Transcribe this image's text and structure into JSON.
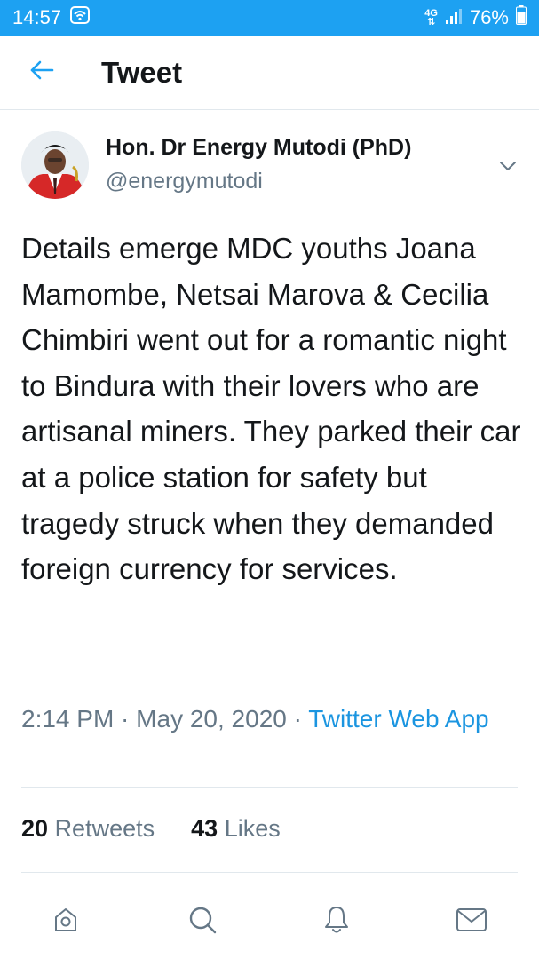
{
  "status_bar": {
    "time": "14:57",
    "network_label_top": "4G",
    "network_label_bottom": "⇅",
    "battery": "76%",
    "icons": [
      "wifi-icon",
      "signal-icon",
      "battery-icon"
    ]
  },
  "header": {
    "title": "Tweet",
    "back_icon": "back-arrow-icon"
  },
  "tweet": {
    "author": {
      "display_name": "Hon. Dr Energy Mutodi (PhD)",
      "handle": "@energymutodi"
    },
    "text": "Details emerge MDC youths Joana Mamombe, Netsai Marova & Cecilia Chimbiri went out for a romantic night to Bindura with their lovers who are artisanal miners. They parked their car at a police station for safety but tragedy struck when they demanded foreign currency for services.",
    "time": "2:14 PM",
    "separator": " · ",
    "date": "May 20, 2020",
    "source": "Twitter Web App",
    "stats": {
      "retweets_count": "20",
      "retweets_label": "Retweets",
      "likes_count": "43",
      "likes_label": "Likes"
    }
  },
  "bottom_nav": {
    "items": [
      "home-icon",
      "search-icon",
      "notifications-icon",
      "messages-icon"
    ]
  },
  "colors": {
    "accent": "#1da1f2",
    "link": "#1b95e0",
    "secondary_text": "#657786",
    "divider": "#e1e8ed"
  }
}
